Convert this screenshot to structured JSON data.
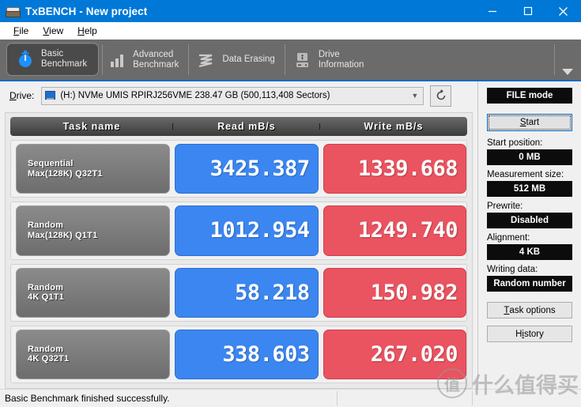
{
  "window": {
    "title": "TxBENCH - New project",
    "icon": "disk-icon",
    "minimize_label": "Minimize",
    "maximize_label": "Maximize",
    "close_label": "Close"
  },
  "menu": {
    "items": [
      {
        "label": "File",
        "mnemonic": "F"
      },
      {
        "label": "View",
        "mnemonic": "V"
      },
      {
        "label": "Help",
        "mnemonic": "H"
      }
    ]
  },
  "tabs": [
    {
      "label": "Basic\nBenchmark",
      "icon": "stopwatch-icon",
      "active": true
    },
    {
      "label": "Advanced\nBenchmark",
      "icon": "bar-chart-icon",
      "active": false
    },
    {
      "label": "Data Erasing",
      "icon": "eraser-wave-icon",
      "active": false
    },
    {
      "label": "Drive\nInformation",
      "icon": "drive-info-icon",
      "active": false
    }
  ],
  "tab_overflow_icon": "chevron-down-icon",
  "drive": {
    "label": "Drive:",
    "mnemonic": "D",
    "selected": "(H:) NVMe UMIS RPIRJ256VME  238.47 GB (500,113,408 Sectors)",
    "dropdown_icon": "chevron-down-icon",
    "refresh_icon": "refresh-icon"
  },
  "results": {
    "headers": [
      "Task name",
      "Read mB/s",
      "Write mB/s"
    ],
    "rows": [
      {
        "task": "Sequential\nMax(128K) Q32T1",
        "read": "3425.387",
        "write": "1339.668"
      },
      {
        "task": "Random\nMax(128K) Q1T1",
        "read": "1012.954",
        "write": "1249.740"
      },
      {
        "task": "Random\n4K Q1T1",
        "read": "58.218",
        "write": "150.982"
      },
      {
        "task": "Random\n4K Q32T1",
        "read": "338.603",
        "write": "267.020"
      }
    ]
  },
  "sidebar": {
    "mode": "FILE mode",
    "start_button": "Start",
    "start_button_mnemonic": "S",
    "fields": [
      {
        "label": "Start position:",
        "value": "0 MB"
      },
      {
        "label": "Measurement size:",
        "value": "512 MB"
      },
      {
        "label": "Prewrite:",
        "value": "Disabled"
      },
      {
        "label": "Alignment:",
        "value": "4 KB"
      },
      {
        "label": "Writing data:",
        "value": "Random number"
      }
    ],
    "task_options_button": "Task options",
    "task_options_mnemonic": "T",
    "history_button": "History",
    "history_mnemonic": "i"
  },
  "statusbar": {
    "message": "Basic Benchmark finished successfully."
  },
  "watermark": {
    "badge": "值",
    "text": "什么值得买"
  },
  "colors": {
    "titlebar": "#0078d7",
    "read_value": "#3b86f0",
    "write_value": "#ea5360",
    "tabstrip": "#6b6b6b",
    "dark_field": "#0c0c0c"
  }
}
